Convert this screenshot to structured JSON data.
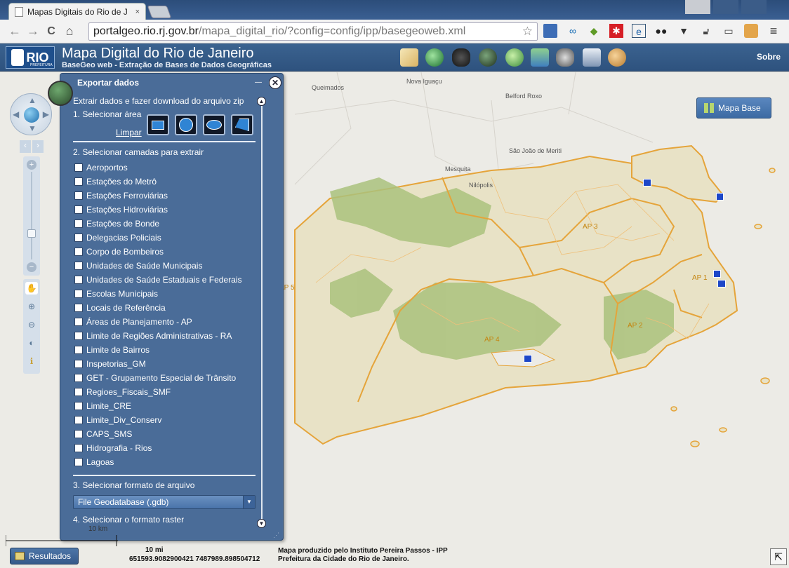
{
  "browser": {
    "tab_title": "Mapas Digitais do Rio de J",
    "tab_close": "×",
    "url_host": "portalgeo.rio.rj.gov.br",
    "url_path": "/mapa_digital_rio/?config=config/ipp/basegeoweb.xml",
    "back": "←",
    "forward": "→",
    "reload": "C",
    "home": "⌂",
    "star": "☆",
    "menu": "≡"
  },
  "app": {
    "logo_text": "RIO",
    "logo_sub": "PREFEITURA",
    "title": "Mapa Digital do Rio de Janeiro",
    "subtitle": "BaseGeo web - Extração de Bases de Dados Geográficas",
    "sobre": "Sobre",
    "header_icons": [
      "map-icon",
      "search-globe-icon",
      "binoculars-icon",
      "globe-dark-icon",
      "mapa-globe-icon",
      "layers-icon",
      "camera-icon",
      "print-icon",
      "palette-icon"
    ],
    "header_icon_label": "MAPA"
  },
  "map": {
    "places": [
      "Queimados",
      "Nova Iguaçu",
      "Belford Roxo",
      "São João de Meriti",
      "Mesquita",
      "Nilópolis"
    ],
    "regions": [
      "AP 3",
      "AP 5",
      "AP 1",
      "AP 2",
      "AP 4"
    ],
    "mapa_base_label": "Mapa Base",
    "colors": {
      "land": "#e6e0c4",
      "relief": "#a7c07b",
      "ap_border": "#e0a030",
      "water": "#ecebe6"
    }
  },
  "panel": {
    "title": "Exportar dados",
    "description": "Extrair dados e fazer download do arquivo zip",
    "step1": "1. Selecionar área",
    "limpar": "Limpar",
    "step2": "2. Selecionar camadas para extrair",
    "layers": [
      "Aeroportos",
      "Estações do Metrô",
      "Estações Ferroviárias",
      "Estações Hidroviárias",
      "Estações de Bonde",
      "Delegacias Policiais",
      "Corpo de Bombeiros",
      "Unidades de Saúde Municipais",
      "Unidades de Saúde Estaduais e Federais",
      "Escolas Municipais",
      "Locais de Referência",
      "Áreas de Planejamento - AP",
      "Limite de Regiões Administrativas - RA",
      "Limite de Bairros",
      "Inspetorias_GM",
      "GET - Grupamento Especial de Trânsito",
      "Regioes_Fiscais_SMF",
      "Limite_CRE",
      "Limite_Div_Conserv",
      "CAPS_SMS",
      "Hidrografia - Rios",
      "Lagoas"
    ],
    "step3": "3. Selecionar formato de arquivo",
    "format_selected": "File Geodatabase (.gdb)",
    "step4": "4. Selecionar o formato raster",
    "minimize": "—",
    "close": "✕"
  },
  "footer": {
    "scale_km": "10 km",
    "scale_mi": "10 mi",
    "coordinates": "651593.9082900421 7487989.898504712",
    "credit_line1": "Mapa produzido pelo Instituto Pereira Passos - IPP",
    "credit_line2": "Prefeitura da Cidade do Rio de Janeiro.",
    "resultados": "Resultados"
  }
}
